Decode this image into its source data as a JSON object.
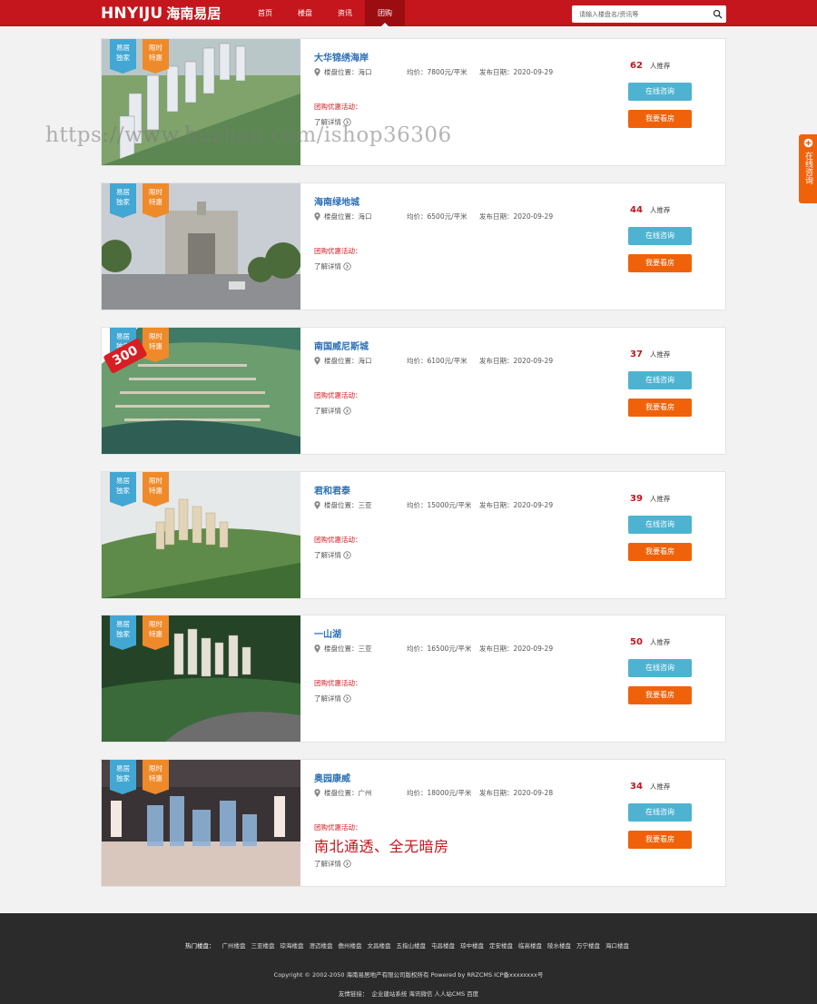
{
  "header": {
    "logo_en": "HNYIJU",
    "logo_cn": "海南易居",
    "nav": [
      "首页",
      "楼盘",
      "资讯",
      "团购"
    ],
    "active_nav": 3,
    "search_placeholder": "请输入楼盘名/资讯等"
  },
  "card_labels": {
    "tag_blue_1": "易居",
    "tag_blue_2": "独家",
    "tag_orange_1": "限时",
    "tag_orange_2": "特惠",
    "location_prefix": "楼盘位置：",
    "price_prefix": "均价：",
    "date_prefix": "发布日期：",
    "promo_label": "团购优惠活动：",
    "more_label": "了解详情",
    "recommend_label": "人推荐",
    "consult_button": "在线咨询",
    "visit_button": "我要看房"
  },
  "listings": [
    {
      "title": "大华锦绣海岸",
      "location": "海口",
      "price": "7800元/平米",
      "date": "2020-09-29",
      "count": "62"
    },
    {
      "title": "海南绿地城",
      "location": "海口",
      "price": "6500元/平米",
      "date": "2020-09-29",
      "count": "44"
    },
    {
      "title": "南国威尼斯城",
      "location": "海口",
      "price": "6100元/平米",
      "date": "2020-09-29",
      "count": "37",
      "ribbon": "300"
    },
    {
      "title": "君和君泰",
      "location": "三亚",
      "price": "15000元/平米",
      "date": "2020-09-29",
      "count": "39"
    },
    {
      "title": "一山湖",
      "location": "三亚",
      "price": "16500元/平米",
      "date": "2020-09-29",
      "count": "50"
    },
    {
      "title": "奥园康威",
      "location": "广州",
      "price": "18000元/平米",
      "date": "2020-09-28",
      "count": "34",
      "big_promo": "南北通透、全无暗房"
    }
  ],
  "watermark": "https://www.huzhan.com/ishop36306",
  "side": {
    "text": "在线咨询"
  },
  "footer": {
    "cities_lead": "热门楼盘：",
    "cities": [
      "广州楼盘",
      "三亚楼盘",
      "琼海楼盘",
      "澄迈楼盘",
      "儋州楼盘",
      "文昌楼盘",
      "五指山楼盘",
      "屯昌楼盘",
      "琼中楼盘",
      "定安楼盘",
      "临高楼盘",
      "陵水楼盘",
      "万宁楼盘",
      "海口楼盘"
    ],
    "copyright": "Copyright © 2002-2050 海南易居地产有限公司版权所有 Powered by RRZCMS   ICP备xxxxxxxx号",
    "links_lead": "友情链接：",
    "links": [
      "企业建站系统",
      "海讯微信",
      "人人站CMS",
      "百度"
    ]
  },
  "colors": {
    "brand": "#c4161c",
    "consult": "#4eb3d1",
    "visit": "#f0620a",
    "title": "#2a6fb5"
  }
}
